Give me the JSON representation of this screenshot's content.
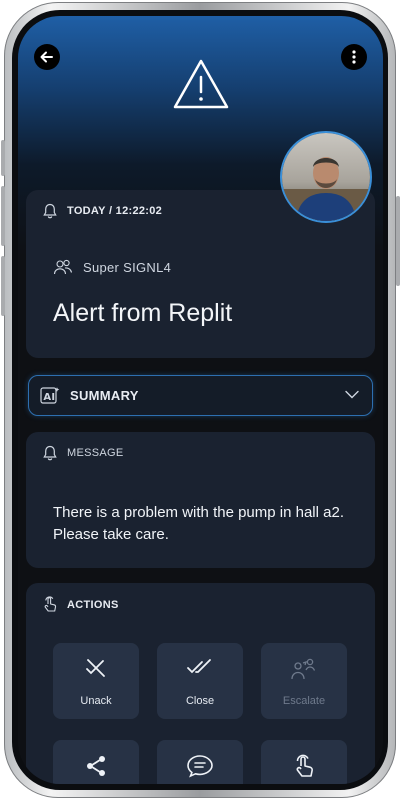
{
  "alert": {
    "timestamp": "TODAY / 12:22:02",
    "team": "Super SIGNL4",
    "title": "Alert from Replit"
  },
  "summary": {
    "label": "SUMMARY"
  },
  "message": {
    "label": "MESSAGE",
    "text": "There is a problem with the pump in hall a2. Please take care."
  },
  "actions": {
    "label": "ACTIONS",
    "buttons": [
      {
        "label": "Unack",
        "icon": "unack-icon",
        "enabled": true
      },
      {
        "label": "Close",
        "icon": "double-check-icon",
        "enabled": true
      },
      {
        "label": "Escalate",
        "icon": "escalate-icon",
        "enabled": false
      }
    ],
    "second_row_icons": [
      "share-icon",
      "comment-icon",
      "touch-icon"
    ]
  },
  "colors": {
    "accent": "#2d6fb0",
    "card": "#1a2230",
    "background": "#0e1014"
  }
}
